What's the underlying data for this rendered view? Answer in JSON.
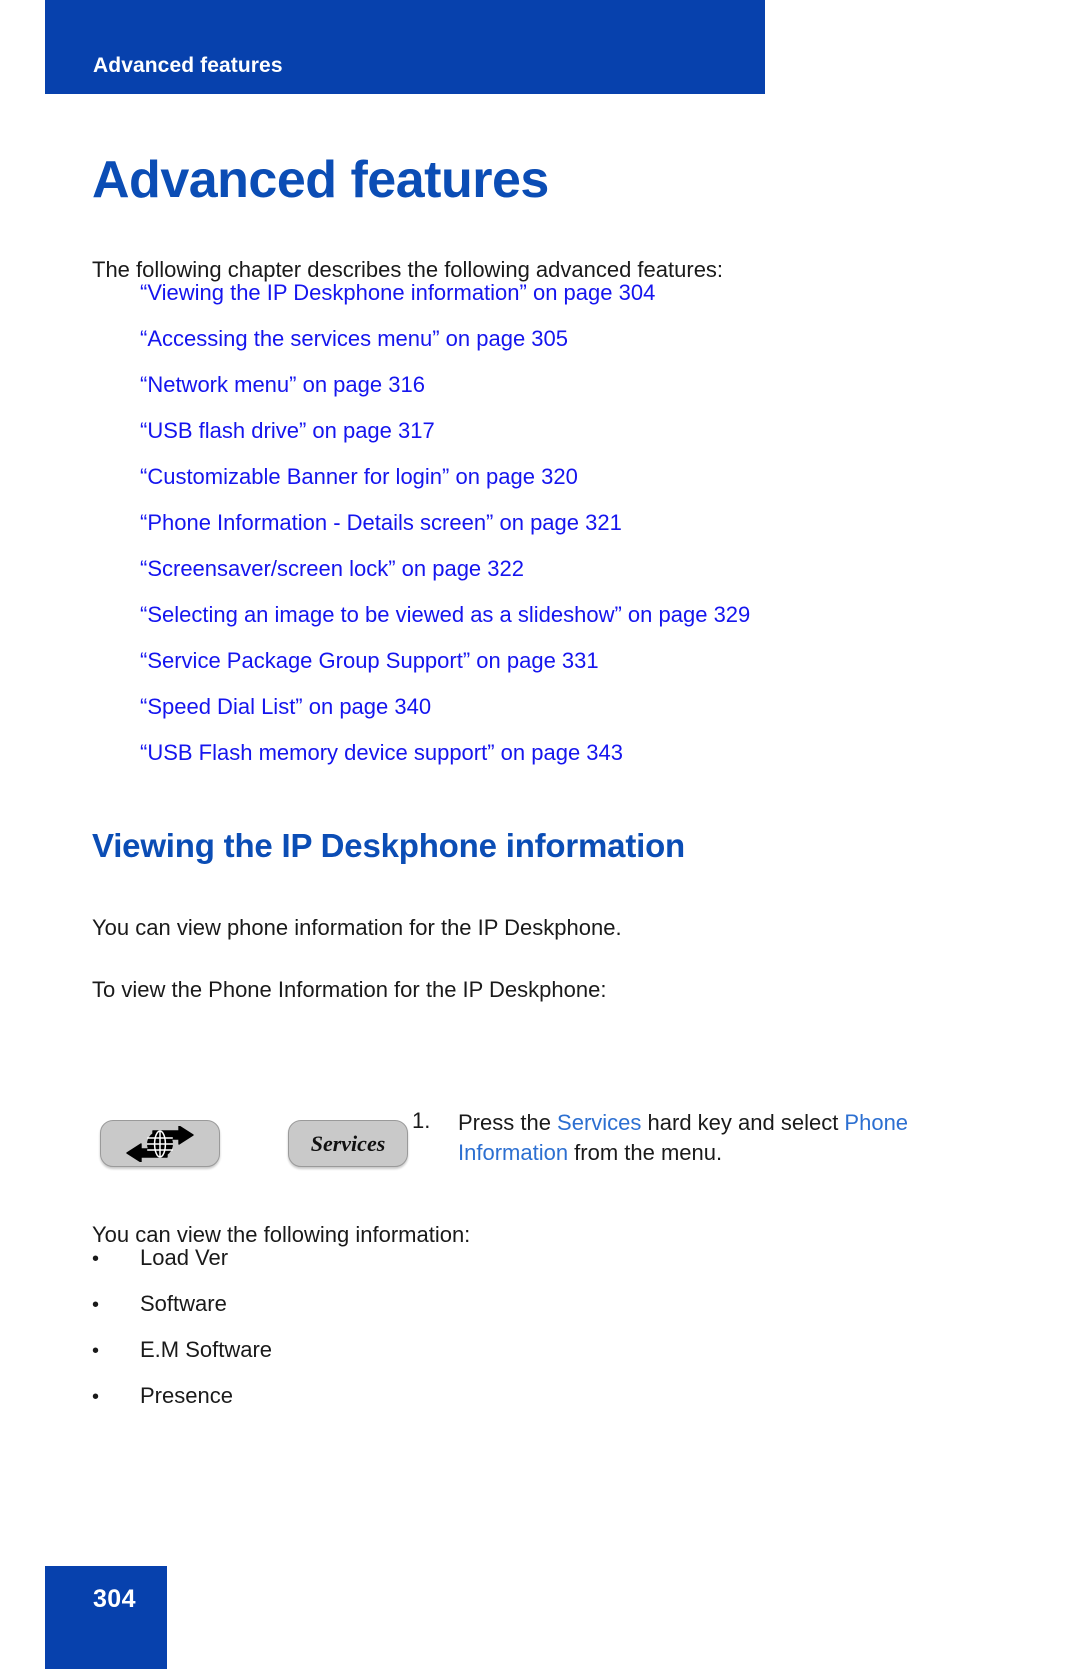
{
  "colors": {
    "brand_blue": "#0741AD",
    "heading_blue": "#0B4DB5",
    "link_blue": "#1515EE",
    "ui_term_blue": "#2C6FD1",
    "key_gray": "#C9C9C9",
    "body_black": "#1a1a1a"
  },
  "header": {
    "running_head": "Advanced features"
  },
  "chapter": {
    "title": "Advanced features",
    "intro": "The following chapter describes the following advanced features:"
  },
  "xrefs": [
    {
      "label": "“Viewing the IP Deskphone information” on page 304"
    },
    {
      "label": "“Accessing the services menu” on page 305"
    },
    {
      "label": "“Network menu” on page 316"
    },
    {
      "label": "“USB flash drive” on page 317"
    },
    {
      "label": "“Customizable Banner for login” on page 320"
    },
    {
      "label": "“Phone Information - Details screen” on page 321"
    },
    {
      "label": "“Screensaver/screen lock” on page 322"
    },
    {
      "label": "“Selecting an image to be viewed as a slideshow” on page 329"
    },
    {
      "label": "“Service Package Group Support” on page 331"
    },
    {
      "label": "“Speed Dial List” on page 340"
    },
    {
      "label": "“USB Flash memory device support” on page 343"
    }
  ],
  "section": {
    "heading": "Viewing the IP Deskphone information",
    "para_view_info": "You can view phone information for the IP Deskphone.",
    "para_to_view": "To view the Phone Information for the IP Deskphone:",
    "para_following": "You can view the following information:"
  },
  "procedure": {
    "keys": {
      "globe_key_name": "globe-network-key",
      "services_key_label": "Services"
    },
    "step": {
      "number": "1.",
      "text_part_1": "Press the ",
      "term_1": "Services",
      "text_part_2": " hard key and select ",
      "term_2": "Phone Information",
      "text_part_3": " from the menu."
    }
  },
  "info_items": [
    {
      "bullet": "•",
      "label": "Load Ver"
    },
    {
      "bullet": "•",
      "label": "Software"
    },
    {
      "bullet": "•",
      "label": "E.M Software"
    },
    {
      "bullet": "•",
      "label": "Presence"
    }
  ],
  "footer": {
    "page_number": "304"
  }
}
